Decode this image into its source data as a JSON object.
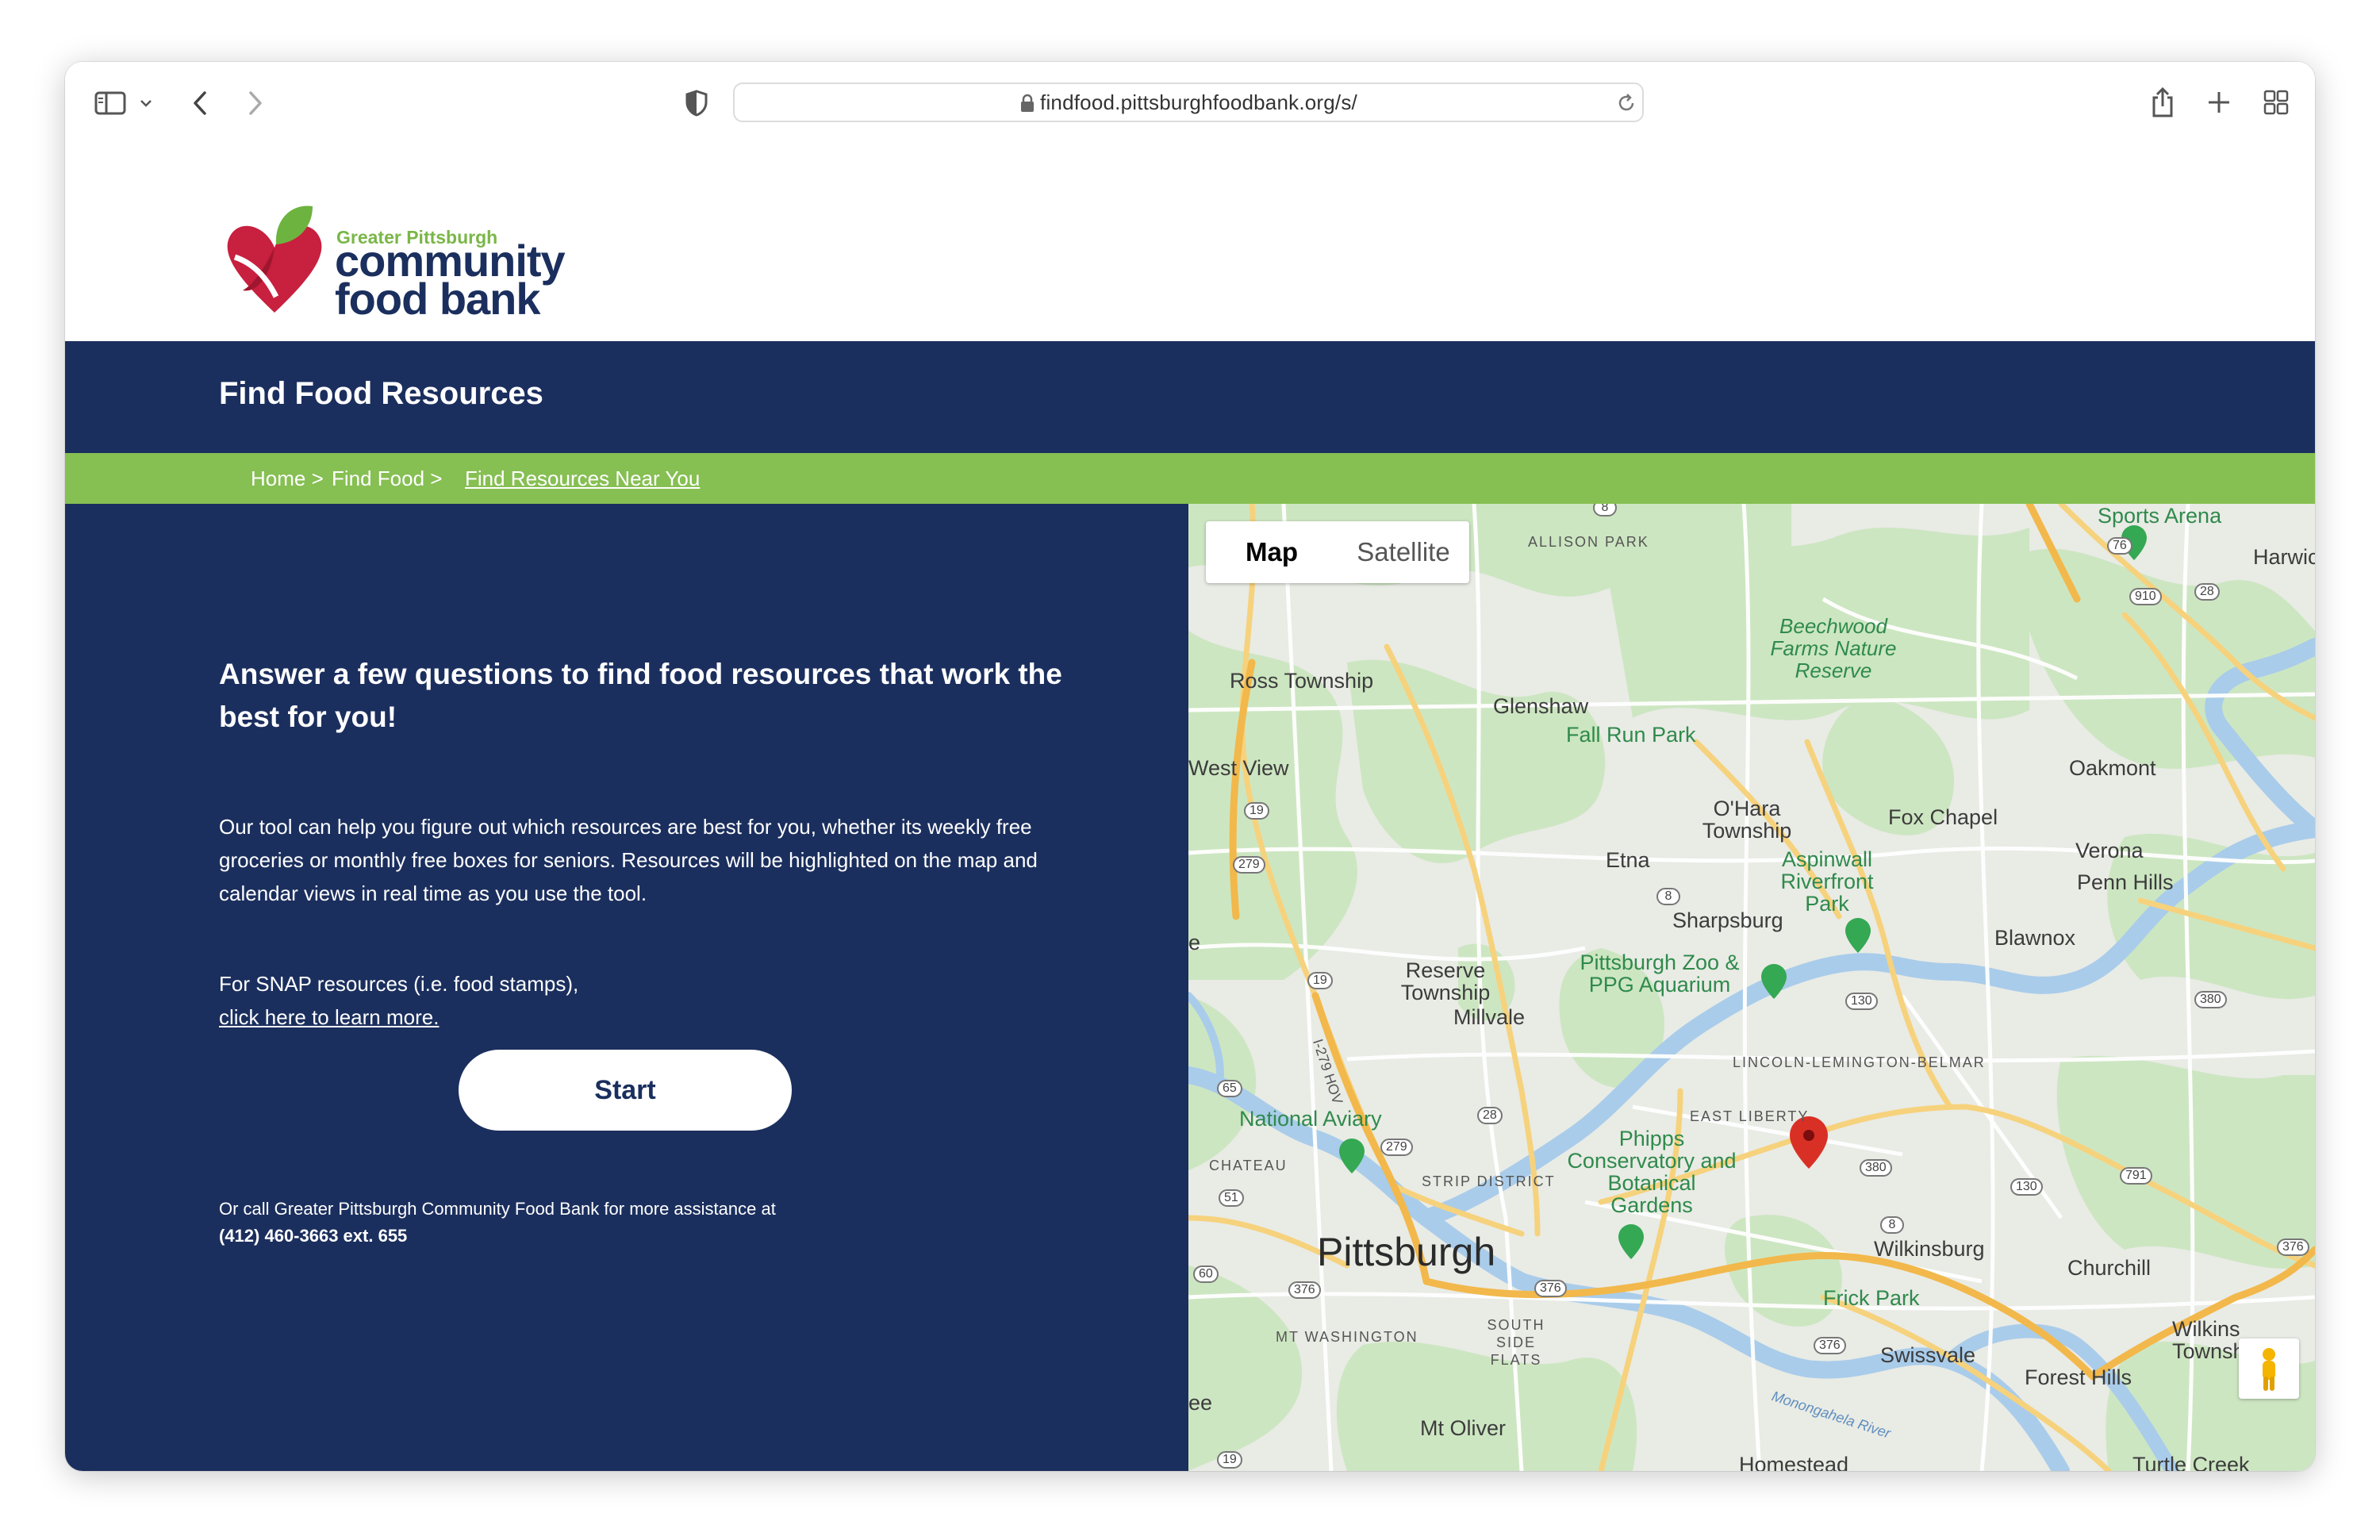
{
  "browser": {
    "url": "findfood.pittsburghfoodbank.org/s/"
  },
  "logo": {
    "line1": "Greater Pittsburgh",
    "line2": "community",
    "line3": "food bank"
  },
  "header": {
    "title": "Find Food Resources"
  },
  "breadcrumb": {
    "home": "Home >",
    "find_food": "Find Food >",
    "current": "Find Resources Near You"
  },
  "intro": {
    "heading": "Answer a few questions to find food resources that work the best for you!",
    "description": "Our tool can help you figure out which resources are best for you, whether its weekly free groceries or monthly free boxes for seniors. Resources will be highlighted on the map and calendar views in real time as you use the tool.",
    "snap_text": "For SNAP resources (i.e. food stamps),",
    "snap_link": "click here to learn more.",
    "start_button": "Start",
    "call_text": "Or call Greater Pittsburgh Community Food Bank for more assistance at",
    "phone": "(412) 460-3663 ext. 655"
  },
  "map": {
    "toggle_map": "Map",
    "toggle_satellite": "Satellite",
    "places": [
      "Ross Township",
      "Glenshaw",
      "West View",
      "O'Hara Township",
      "Fox Chapel",
      "Oakmont",
      "Verona",
      "Penn Hills",
      "Etna",
      "Sharpsburg",
      "Blawnox",
      "Reserve Township",
      "Millvale",
      "Wilkinsburg",
      "Churchill",
      "Swissvale",
      "Forest Hills",
      "Mt Oliver",
      "Homestead",
      "Turtle Creek",
      "Wilkins Townsh",
      "Harwic",
      "e",
      "ee"
    ],
    "city": "Pittsburgh",
    "districts": [
      "ALLISON PARK",
      "LINCOLN-LEMINGTON-BELMAR",
      "EAST LIBERTY",
      "CHATEAU",
      "STRIP DISTRICT",
      "MT WASHINGTON",
      "SOUTH SIDE FLATS"
    ],
    "parks": [
      "Beechwood Farms Nature Reserve",
      "Fall Run Park",
      "Aspinwall Riverfront Park",
      "Pittsburgh Zoo & PPG Aquarium",
      "National Aviary",
      "Phipps Conservatory and Botanical Gardens",
      "Frick Park",
      "Sports Arena",
      "Monongahela River",
      "I-279 HOV"
    ],
    "shields": [
      "8",
      "76",
      "910",
      "28",
      "19",
      "279",
      "8",
      "19",
      "130",
      "380",
      "65",
      "28",
      "279",
      "380",
      "791",
      "130",
      "51",
      "8",
      "376",
      "60",
      "376",
      "376",
      "376",
      "19"
    ]
  }
}
